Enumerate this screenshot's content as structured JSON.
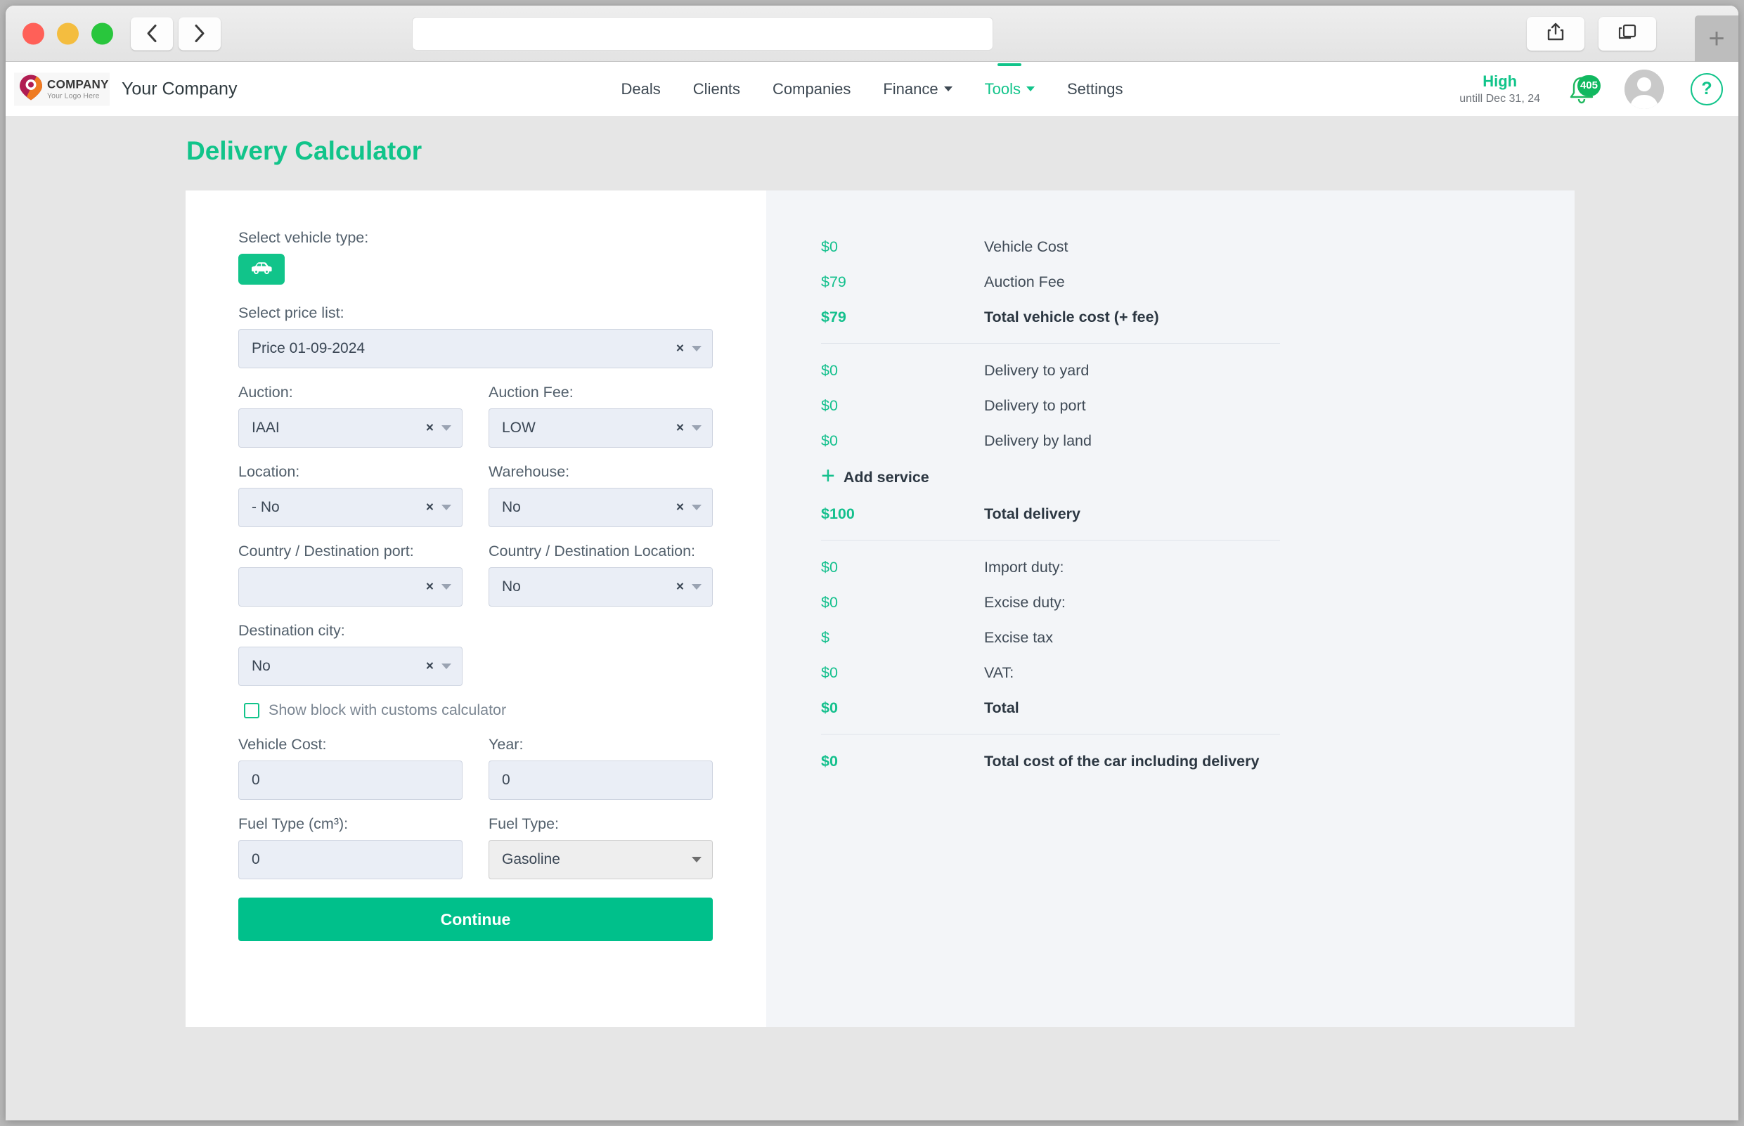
{
  "browser": {
    "url_value": "",
    "url_placeholder": "",
    "back_icon": "chevron-left-icon",
    "forward_icon": "chevron-right-icon",
    "share_icon": "share-icon",
    "tabs_icon": "tab-overview-icon",
    "new_tab_label": "+"
  },
  "header": {
    "logo_title": "COMPANY",
    "logo_subtitle": "Your Logo Here",
    "brand_name": "Your Company",
    "nav": [
      {
        "label": "Deals",
        "has_caret": false,
        "active": false
      },
      {
        "label": "Clients",
        "has_caret": false,
        "active": false
      },
      {
        "label": "Companies",
        "has_caret": false,
        "active": false
      },
      {
        "label": "Finance",
        "has_caret": true,
        "active": false
      },
      {
        "label": "Tools",
        "has_caret": true,
        "active": true
      },
      {
        "label": "Settings",
        "has_caret": false,
        "active": false
      }
    ],
    "plan_name": "High",
    "plan_until": "untill Dec 31, 24",
    "notification_count": "405",
    "help_label": "?"
  },
  "page": {
    "title": "Delivery Calculator"
  },
  "form": {
    "vehicle_type_label": "Select vehicle type:",
    "vehicle_type_icon": "car-icon",
    "price_list_label": "Select price list:",
    "price_list_value": "Price 01-09-2024",
    "auction_label": "Auction:",
    "auction_value": "IAAI",
    "auction_fee_label": "Auction Fee:",
    "auction_fee_value": "LOW",
    "location_label": "Location:",
    "location_value": "- No",
    "warehouse_label": "Warehouse:",
    "warehouse_value": "No",
    "dest_port_label": "Country / Destination port:",
    "dest_port_value": "",
    "dest_location_label": "Country / Destination Location:",
    "dest_location_value": "No",
    "dest_city_label": "Destination city:",
    "dest_city_value": "No",
    "customs_checkbox_label": "Show block with customs calculator",
    "vehicle_cost_label": "Vehicle Cost:",
    "vehicle_cost_value": "0",
    "year_label": "Year:",
    "year_value": "0",
    "engine_volume_label": "Fuel Type (cm³):",
    "engine_volume_value": "0",
    "fuel_type_label": "Fuel Type:",
    "fuel_type_value": "Gasoline",
    "continue_label": "Continue",
    "clear_glyph": "×"
  },
  "summary": {
    "group1": [
      {
        "amount": "$0",
        "label": "Vehicle Cost",
        "bold": false
      },
      {
        "amount": "$79",
        "label": "Auction Fee",
        "bold": false
      },
      {
        "amount": "$79",
        "label": "Total vehicle cost (+ fee)",
        "bold": true
      }
    ],
    "group2": [
      {
        "amount": "$0",
        "label": "Delivery to yard",
        "bold": false
      },
      {
        "amount": "$0",
        "label": "Delivery to port",
        "bold": false
      },
      {
        "amount": "$0",
        "label": "Delivery by land",
        "bold": false
      }
    ],
    "add_service_label": "Add service",
    "add_service_icon": "plus-icon",
    "total_delivery": {
      "amount": "$100",
      "label": "Total delivery",
      "bold": true
    },
    "group3": [
      {
        "amount": "$0",
        "label": "Import duty:",
        "bold": false
      },
      {
        "amount": "$0",
        "label": "Excise duty:",
        "bold": false
      },
      {
        "amount": "$",
        "label": "Excise tax",
        "bold": false
      },
      {
        "amount": "$0",
        "label": "VAT:",
        "bold": false
      },
      {
        "amount": "$0",
        "label": "Total",
        "bold": true
      }
    ],
    "grand_total": {
      "amount": "$0",
      "label": "Total cost of the car including delivery",
      "bold": true
    }
  },
  "colors": {
    "accent": "#11c48a",
    "accent_dark": "#00c08b",
    "page_bg": "#e6e6e6",
    "summary_bg": "#f3f5f8",
    "input_bg": "#eaeef6"
  }
}
